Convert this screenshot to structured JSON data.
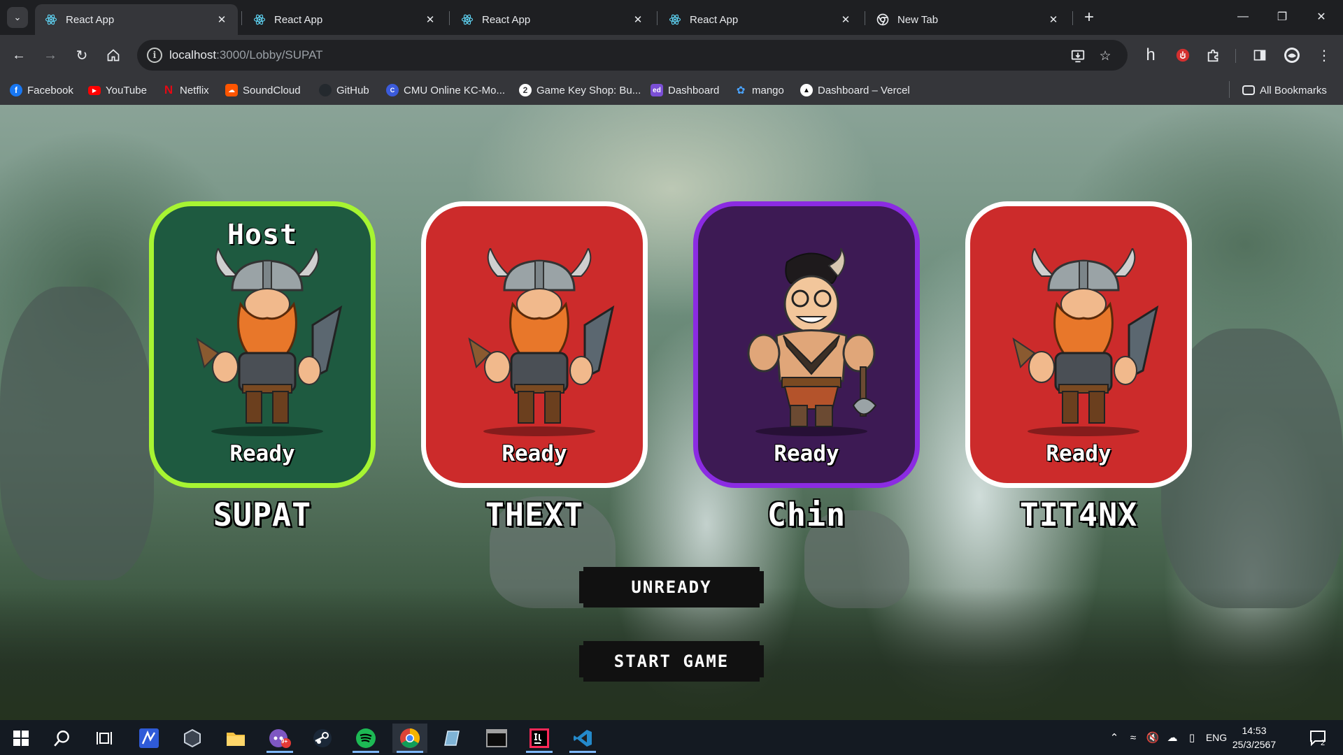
{
  "browser": {
    "tabs": [
      {
        "title": "React App",
        "active": true,
        "icon": "react-icon"
      },
      {
        "title": "React App",
        "active": false,
        "icon": "react-icon"
      },
      {
        "title": "React App",
        "active": false,
        "icon": "react-icon"
      },
      {
        "title": "React App",
        "active": false,
        "icon": "react-icon"
      },
      {
        "title": "New Tab",
        "active": false,
        "icon": "chrome-icon"
      }
    ],
    "url": {
      "host": "localhost",
      "rest": ":3000/Lobby/SUPAT"
    },
    "bookmarks": [
      {
        "label": "Facebook",
        "icon": "facebook-icon",
        "color": "#1877f2"
      },
      {
        "label": "YouTube",
        "icon": "youtube-icon",
        "color": "#ff0000"
      },
      {
        "label": "Netflix",
        "icon": "netflix-icon",
        "color": "#e50914"
      },
      {
        "label": "SoundCloud",
        "icon": "soundcloud-icon",
        "color": "#ff5500"
      },
      {
        "label": "GitHub",
        "icon": "github-icon",
        "color": "#24292e"
      },
      {
        "label": "CMU Online KC-Mo...",
        "icon": "cmu-icon",
        "color": "#3b5bdb"
      },
      {
        "label": "Game Key Shop: Bu...",
        "icon": "gamekey-icon",
        "color": "#ffffff"
      },
      {
        "label": "Dashboard",
        "icon": "edpuzzle-icon",
        "color": "#7b4fd6"
      },
      {
        "label": "mango",
        "icon": "mango-icon",
        "color": "#4aa3ff"
      },
      {
        "label": "Dashboard – Vercel",
        "icon": "vercel-icon",
        "color": "#000000"
      }
    ],
    "all_bookmarks": "All Bookmarks",
    "profile_letter": "h"
  },
  "lobby": {
    "host_label": "Host",
    "players": [
      {
        "name": "SUPAT",
        "status": "Ready",
        "is_host": true,
        "card_color": "#1e5a40",
        "border_color": "#a7f432",
        "avatar": "viking-avatar"
      },
      {
        "name": "THEXT",
        "status": "Ready",
        "is_host": false,
        "card_color": "#cc2b2b",
        "border_color": "#ffffff",
        "avatar": "viking-avatar"
      },
      {
        "name": "Chin",
        "status": "Ready",
        "is_host": false,
        "card_color": "#3d1a54",
        "border_color": "#8b2be2",
        "avatar": "barbarian-avatar"
      },
      {
        "name": "TIT4NX",
        "status": "Ready",
        "is_host": false,
        "card_color": "#cc2b2b",
        "border_color": "#ffffff",
        "avatar": "viking-avatar"
      }
    ],
    "unready_label": "UNREADY",
    "start_label": "START GAME"
  },
  "taskbar": {
    "language": "ENG",
    "time": "14:53",
    "date": "25/3/2567",
    "notification_count": "2",
    "discord_badge": "9+"
  }
}
